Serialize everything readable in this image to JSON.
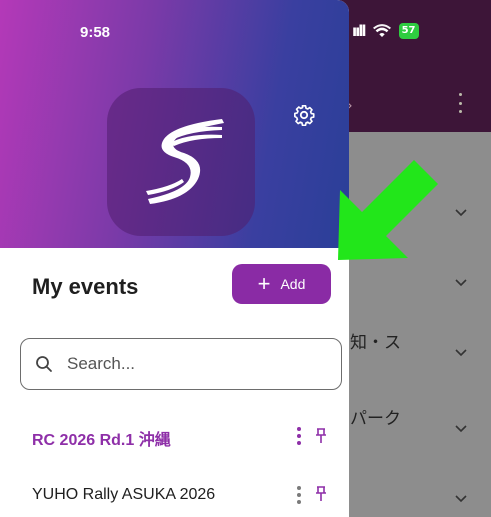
{
  "status_bar": {
    "time": "9:58",
    "battery": "57"
  },
  "background": {
    "rows": [
      {
        "text": ""
      },
      {
        "text": ""
      },
      {
        "text": "知・ス"
      },
      {
        "text": "パーク"
      },
      {
        "text": ""
      }
    ]
  },
  "drawer": {
    "section_title": "My events",
    "add_label": "Add",
    "search_placeholder": "Search...",
    "events": [
      {
        "name": "RC 2026 Rd.1 沖縄",
        "active": true
      },
      {
        "name": "YUHO Rally ASUKA 2026",
        "active": false
      }
    ]
  },
  "colors": {
    "accent": "#8a2ba5",
    "arrow": "#22e61a",
    "battery": "#2ecc40"
  },
  "icons": [
    "settings-gear-icon",
    "search-icon",
    "more-vert-icon",
    "pin-icon",
    "chevron-down-icon",
    "wifi-icon",
    "cellular-icon",
    "app-logo"
  ]
}
